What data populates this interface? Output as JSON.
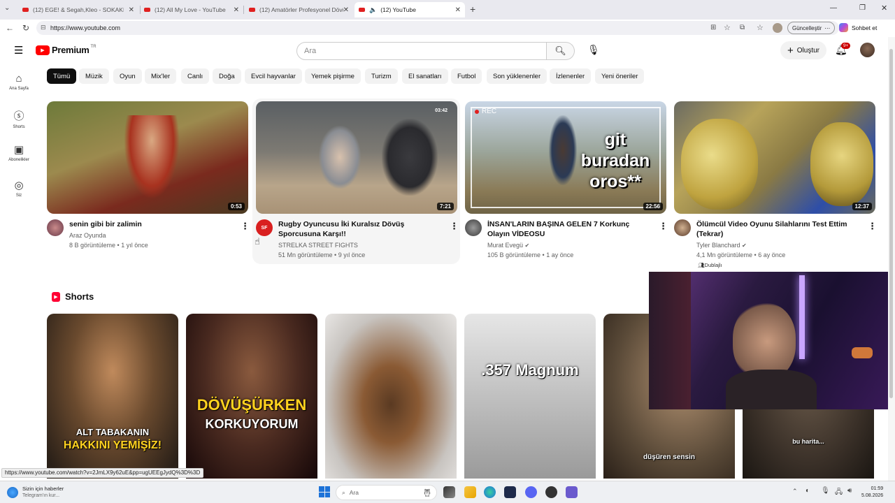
{
  "browser": {
    "tabs": [
      {
        "label": "(12) EGE! & Segah,Kleo - SOKAKL...",
        "active": false
      },
      {
        "label": "(12) All My Love - YouTube",
        "active": false
      },
      {
        "label": "(12) Amatörler Profesyonel Dövüş...",
        "active": false
      },
      {
        "label": "(12) YouTube",
        "active": true
      }
    ],
    "new_tab": "+",
    "url": "https://www.youtube.com",
    "update_button": "Güncelleştir",
    "chat_button": "Sohbet et"
  },
  "youtube": {
    "logo_text": "Premium",
    "logo_region": "TR",
    "search_placeholder": "Ara",
    "create_button": "Oluştur",
    "notification_badge": "9+",
    "sidebar": [
      {
        "label": "Ana Sayfa",
        "icon": "home-icon"
      },
      {
        "label": "Shorts",
        "icon": "shorts-icon"
      },
      {
        "label": "Abonelikler",
        "icon": "subscriptions-icon"
      },
      {
        "label": "Siz",
        "icon": "user-icon"
      }
    ],
    "chips": [
      "Tümü",
      "Müzik",
      "Oyun",
      "Mix'ler",
      "Canlı",
      "Doğa",
      "Evcil hayvanlar",
      "Yemek pişirme",
      "Turizm",
      "El sanatları",
      "Futbol",
      "Son yüklenenler",
      "İzlenenler",
      "Yeni öneriler"
    ],
    "videos": [
      {
        "title": "senin gibi bir zalimin",
        "channel": "Araz Oyunda",
        "stats": "8 B görüntüleme • 1 yıl önce",
        "duration": "0:53",
        "verified": false,
        "badge": ""
      },
      {
        "title": "Rugby Oyuncusu İki Kuralsız Dövüş Sporcusuna Karşı!!",
        "channel": "STRELKA STREET FIGHTS",
        "stats": "51 Mn görüntüleme • 9 yıl önce",
        "duration": "7:21",
        "verified": false,
        "badge": ""
      },
      {
        "title": "İNSAN'LARIN BAŞINA GELEN 7 Korkunç Olayın VİDEOSU",
        "channel": "Murat Evegü",
        "stats": "105 B görüntüleme • 1 ay önce",
        "duration": "22:56",
        "verified": true,
        "badge": "",
        "thumb_text": "git buradan oros**",
        "rec": "REC"
      },
      {
        "title": "Ölümcül Video Oyunu Silahlarını Test Ettim (Tekrar)",
        "channel": "Tyler Blanchard",
        "stats": "4,1 Mn görüntüleme • 6 ay önce",
        "duration": "12:37",
        "verified": true,
        "badge": "Dublajlı"
      }
    ],
    "thumb2_overlay": "03:42",
    "shorts_heading": "Shorts",
    "shorts": [
      {
        "text_top": "ALT TABAKANIN",
        "text_bottom": "HAKKINI YEMİŞİZ!"
      },
      {
        "text_top": "DÖVÜŞÜRKEN",
        "text_bottom": "KORKUYORUM"
      },
      {
        "text_top": "",
        "text_bottom": ""
      },
      {
        "text_top": ".357 Magnum",
        "text_bottom": ""
      },
      {
        "text_top": "",
        "text_bottom": "düşüren sensin"
      },
      {
        "text_top": "bu harita...",
        "text_bottom": ""
      }
    ]
  },
  "status_link": "https://www.youtube.com/watch?v=2JmLX9y62uE&pp=ugUEEgJydQ%3D%3D",
  "taskbar": {
    "news_title": "Sizin için haberler",
    "news_sub": "Telegram'ın kur...",
    "search": "Ara",
    "time": "01:59",
    "date": "5.08.2026"
  }
}
